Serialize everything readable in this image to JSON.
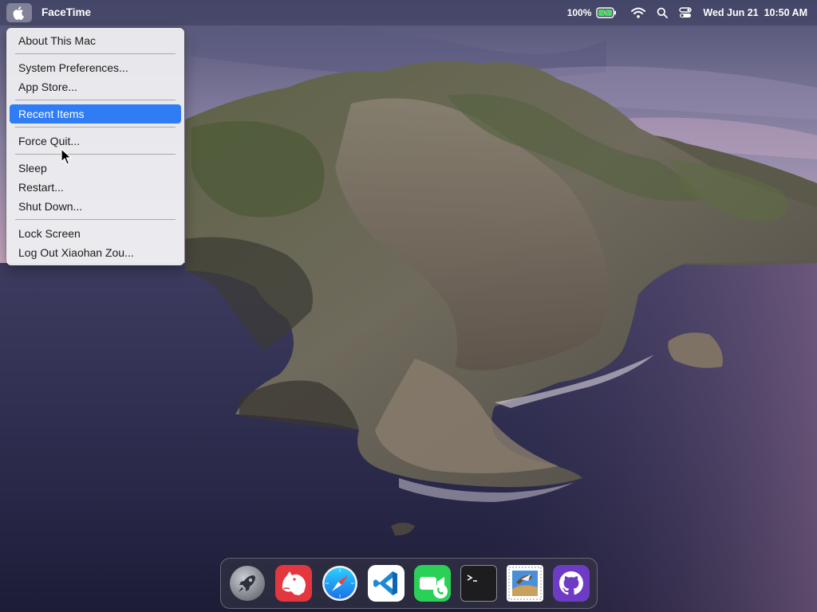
{
  "menubar": {
    "app_name": "FaceTime",
    "battery_percent": "100%",
    "datetime": "Wed Jun 21  10:50 AM",
    "icons": [
      "apple-icon",
      "battery-charging-icon",
      "wifi-icon",
      "search-icon",
      "control-center-icon"
    ]
  },
  "apple_menu": {
    "items": [
      {
        "label": "About This Mac"
      },
      {
        "label": "System Preferences..."
      },
      {
        "label": "App Store..."
      },
      {
        "label": "Recent Items",
        "highlighted": true
      },
      {
        "label": "Force Quit..."
      },
      {
        "label": "Sleep"
      },
      {
        "label": "Restart..."
      },
      {
        "label": "Shut Down..."
      },
      {
        "label": "Lock Screen"
      },
      {
        "label": "Log Out Xiaohan Zou..."
      }
    ]
  },
  "dock": {
    "items": [
      "launchpad-icon",
      "bear-notes-icon",
      "safari-icon",
      "vscode-icon",
      "facetime-icon",
      "terminal-icon",
      "mail-stamp-icon",
      "github-icon"
    ]
  },
  "colors": {
    "menu_highlight": "#2f7cf5",
    "facetime_green": "#2bd157",
    "vscode_blue": "#1f8ad2",
    "github_purple": "#6e3cc4",
    "bear_red": "#e4363e"
  }
}
